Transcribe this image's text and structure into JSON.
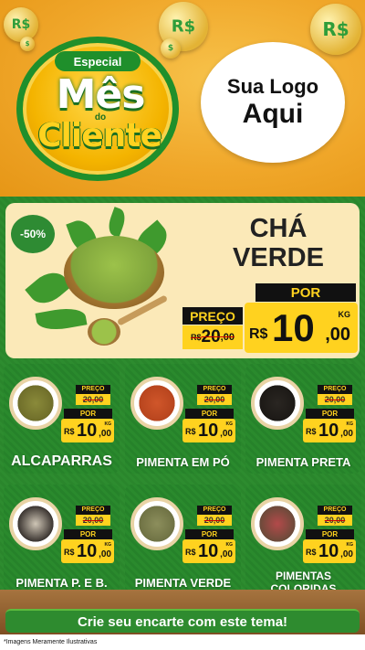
{
  "header": {
    "logo_special": "Especial",
    "logo_mes": "Mês",
    "logo_do": "do",
    "logo_cliente": "Cliente",
    "your_logo_line1": "Sua Logo",
    "your_logo_line2": "Aqui",
    "money_symbol": "R$"
  },
  "hero": {
    "discount": "-50%",
    "title_line1": "CHÁ",
    "title_line2": "VERDE",
    "preco_label": "PREÇO",
    "old_price_int": "20",
    "old_price_dec": ",00",
    "old_price_cur": "R$",
    "por_label": "POR",
    "currency": "R$",
    "price_int": "10",
    "price_dec": ",00",
    "unit": "KG"
  },
  "products": [
    {
      "name": "ALCAPARRAS",
      "preco_label": "PREÇO",
      "old": "20",
      "old_dec": ",00",
      "old_cur": "R$",
      "por_label": "POR",
      "cur": "R$",
      "int": "10",
      "dec": ",00",
      "unit": "KG"
    },
    {
      "name": "PIMENTA EM PÓ",
      "preco_label": "PREÇO",
      "old": "20",
      "old_dec": ",00",
      "old_cur": "R$",
      "por_label": "POR",
      "cur": "R$",
      "int": "10",
      "dec": ",00",
      "unit": "KG"
    },
    {
      "name": "PIMENTA PRETA",
      "preco_label": "PREÇO",
      "old": "20",
      "old_dec": ",00",
      "old_cur": "R$",
      "por_label": "POR",
      "cur": "R$",
      "int": "10",
      "dec": ",00",
      "unit": "KG"
    },
    {
      "name": "PIMENTA P. E B.",
      "preco_label": "PREÇO",
      "old": "20",
      "old_dec": ",00",
      "old_cur": "R$",
      "por_label": "POR",
      "cur": "R$",
      "int": "10",
      "dec": ",00",
      "unit": "KG"
    },
    {
      "name": "PIMENTA VERDE",
      "preco_label": "PREÇO",
      "old": "20",
      "old_dec": ",00",
      "old_cur": "R$",
      "por_label": "POR",
      "cur": "R$",
      "int": "10",
      "dec": ",00",
      "unit": "KG"
    },
    {
      "name_line1": "PIMENTAS",
      "name_line2": "COLORIDAS",
      "preco_label": "PREÇO",
      "old": "20",
      "old_dec": ",00",
      "old_cur": "R$",
      "por_label": "POR",
      "cur": "R$",
      "int": "10",
      "dec": ",00",
      "unit": "KG"
    }
  ],
  "cta": "Crie seu encarte com este tema!",
  "footer": "*Imagens Meramente Ilustrativas",
  "colors": {
    "green": "#2e8b2f",
    "yellow": "#ffd21f",
    "orange": "#f0a72a",
    "cream": "#fbe9b8"
  }
}
